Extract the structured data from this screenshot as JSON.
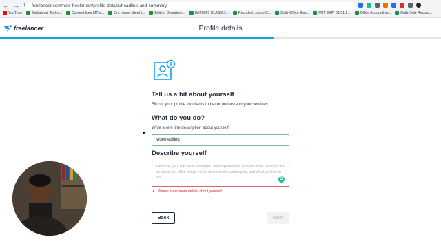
{
  "browser": {
    "url": "freelancer.com/new-freelancer/profile-details/headline-and-summary",
    "bookmarks": [
      {
        "label": "YouTube",
        "icon": "youtube-icon"
      },
      {
        "label": "Mahatmaji Techn...",
        "icon": "sheets-icon"
      },
      {
        "label": "Content Idea MT a...",
        "icon": "sheets-icon"
      },
      {
        "label": "Om owner sheet t...",
        "icon": "sheets-icon"
      },
      {
        "label": "Editing Departme...",
        "icon": "sheets-icon"
      },
      {
        "label": "BATCH 5 CLASS S...",
        "icon": "sheets-icon"
      },
      {
        "label": "Recoded course C...",
        "icon": "sheets-icon"
      },
      {
        "label": "Daily Office Exp...",
        "icon": "sheets-icon"
      },
      {
        "label": "MJT EXP_01.01.2...",
        "icon": "sheets-icon"
      },
      {
        "label": "Office Accounting...",
        "icon": "sheets-icon"
      },
      {
        "label": "Daily Sale Record...",
        "icon": "sheets-icon"
      }
    ]
  },
  "header": {
    "logo_text": "freelancer",
    "title": "Profile details"
  },
  "progress": {
    "fraction": 0.62
  },
  "form": {
    "heading": "Tell us a bit about yourself",
    "subheading": "Fill out your profile for clients to better understand your services.",
    "headline_question": "What do you do?",
    "headline_hint": "Write a one line description about yourself.",
    "headline_value": "video editing",
    "summary_question": "Describe yourself",
    "summary_placeholder": "Describe your top skills, strengths, and experiences. Provide more detail on the services you offer, things you're interested in working on, and what you like to do.",
    "error_text": "Please enter more details about yourself.",
    "back_label": "Back",
    "next_label": "Next"
  },
  "colors": {
    "brand": "#139ff0",
    "text_dark": "#1f2b3d",
    "error": "#d62c3f",
    "valid_border": "#7fbc9a"
  }
}
